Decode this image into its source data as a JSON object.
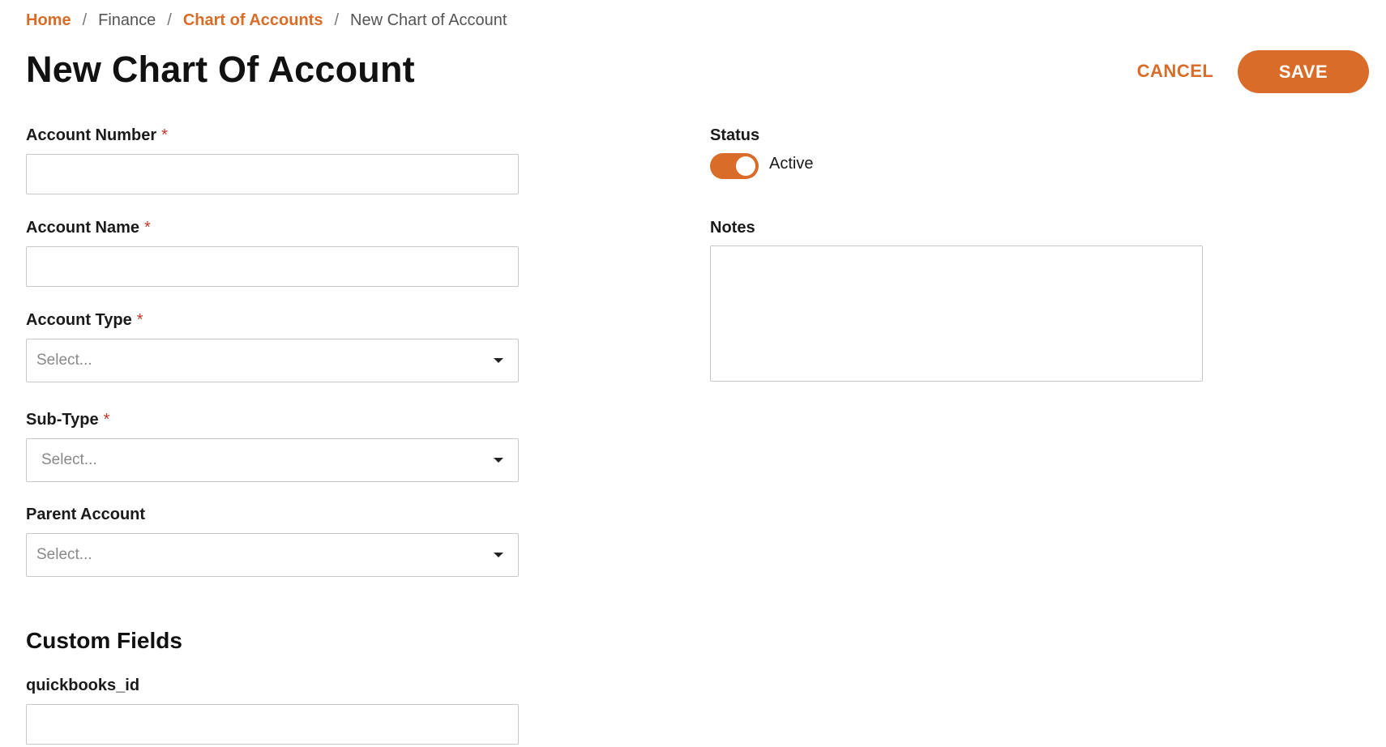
{
  "breadcrumb": {
    "home": "Home",
    "finance": "Finance",
    "chart_of_accounts": "Chart of Accounts",
    "current": "New Chart of Account",
    "separator": "/"
  },
  "page": {
    "title": "New Chart Of Account"
  },
  "actions": {
    "cancel_label": "CANCEL",
    "save_label": "SAVE"
  },
  "form": {
    "account_number": {
      "label": "Account Number",
      "required_mark": "*",
      "value": ""
    },
    "account_name": {
      "label": "Account Name",
      "required_mark": "*",
      "value": ""
    },
    "account_type": {
      "label": "Account Type",
      "required_mark": "*",
      "placeholder": "Select..."
    },
    "sub_type": {
      "label": "Sub-Type",
      "required_mark": "*",
      "placeholder": "Select..."
    },
    "parent_account": {
      "label": "Parent Account",
      "placeholder": "Select..."
    },
    "status": {
      "label": "Status",
      "toggle_label": "Active",
      "enabled": true
    },
    "notes": {
      "label": "Notes",
      "value": ""
    }
  },
  "custom_fields": {
    "title": "Custom Fields",
    "quickbooks_id": {
      "label": "quickbooks_id",
      "value": ""
    }
  },
  "colors": {
    "accent": "#d96c28",
    "required": "#c0392b"
  },
  "icons": {
    "dropdown": "chevron-down-icon"
  }
}
